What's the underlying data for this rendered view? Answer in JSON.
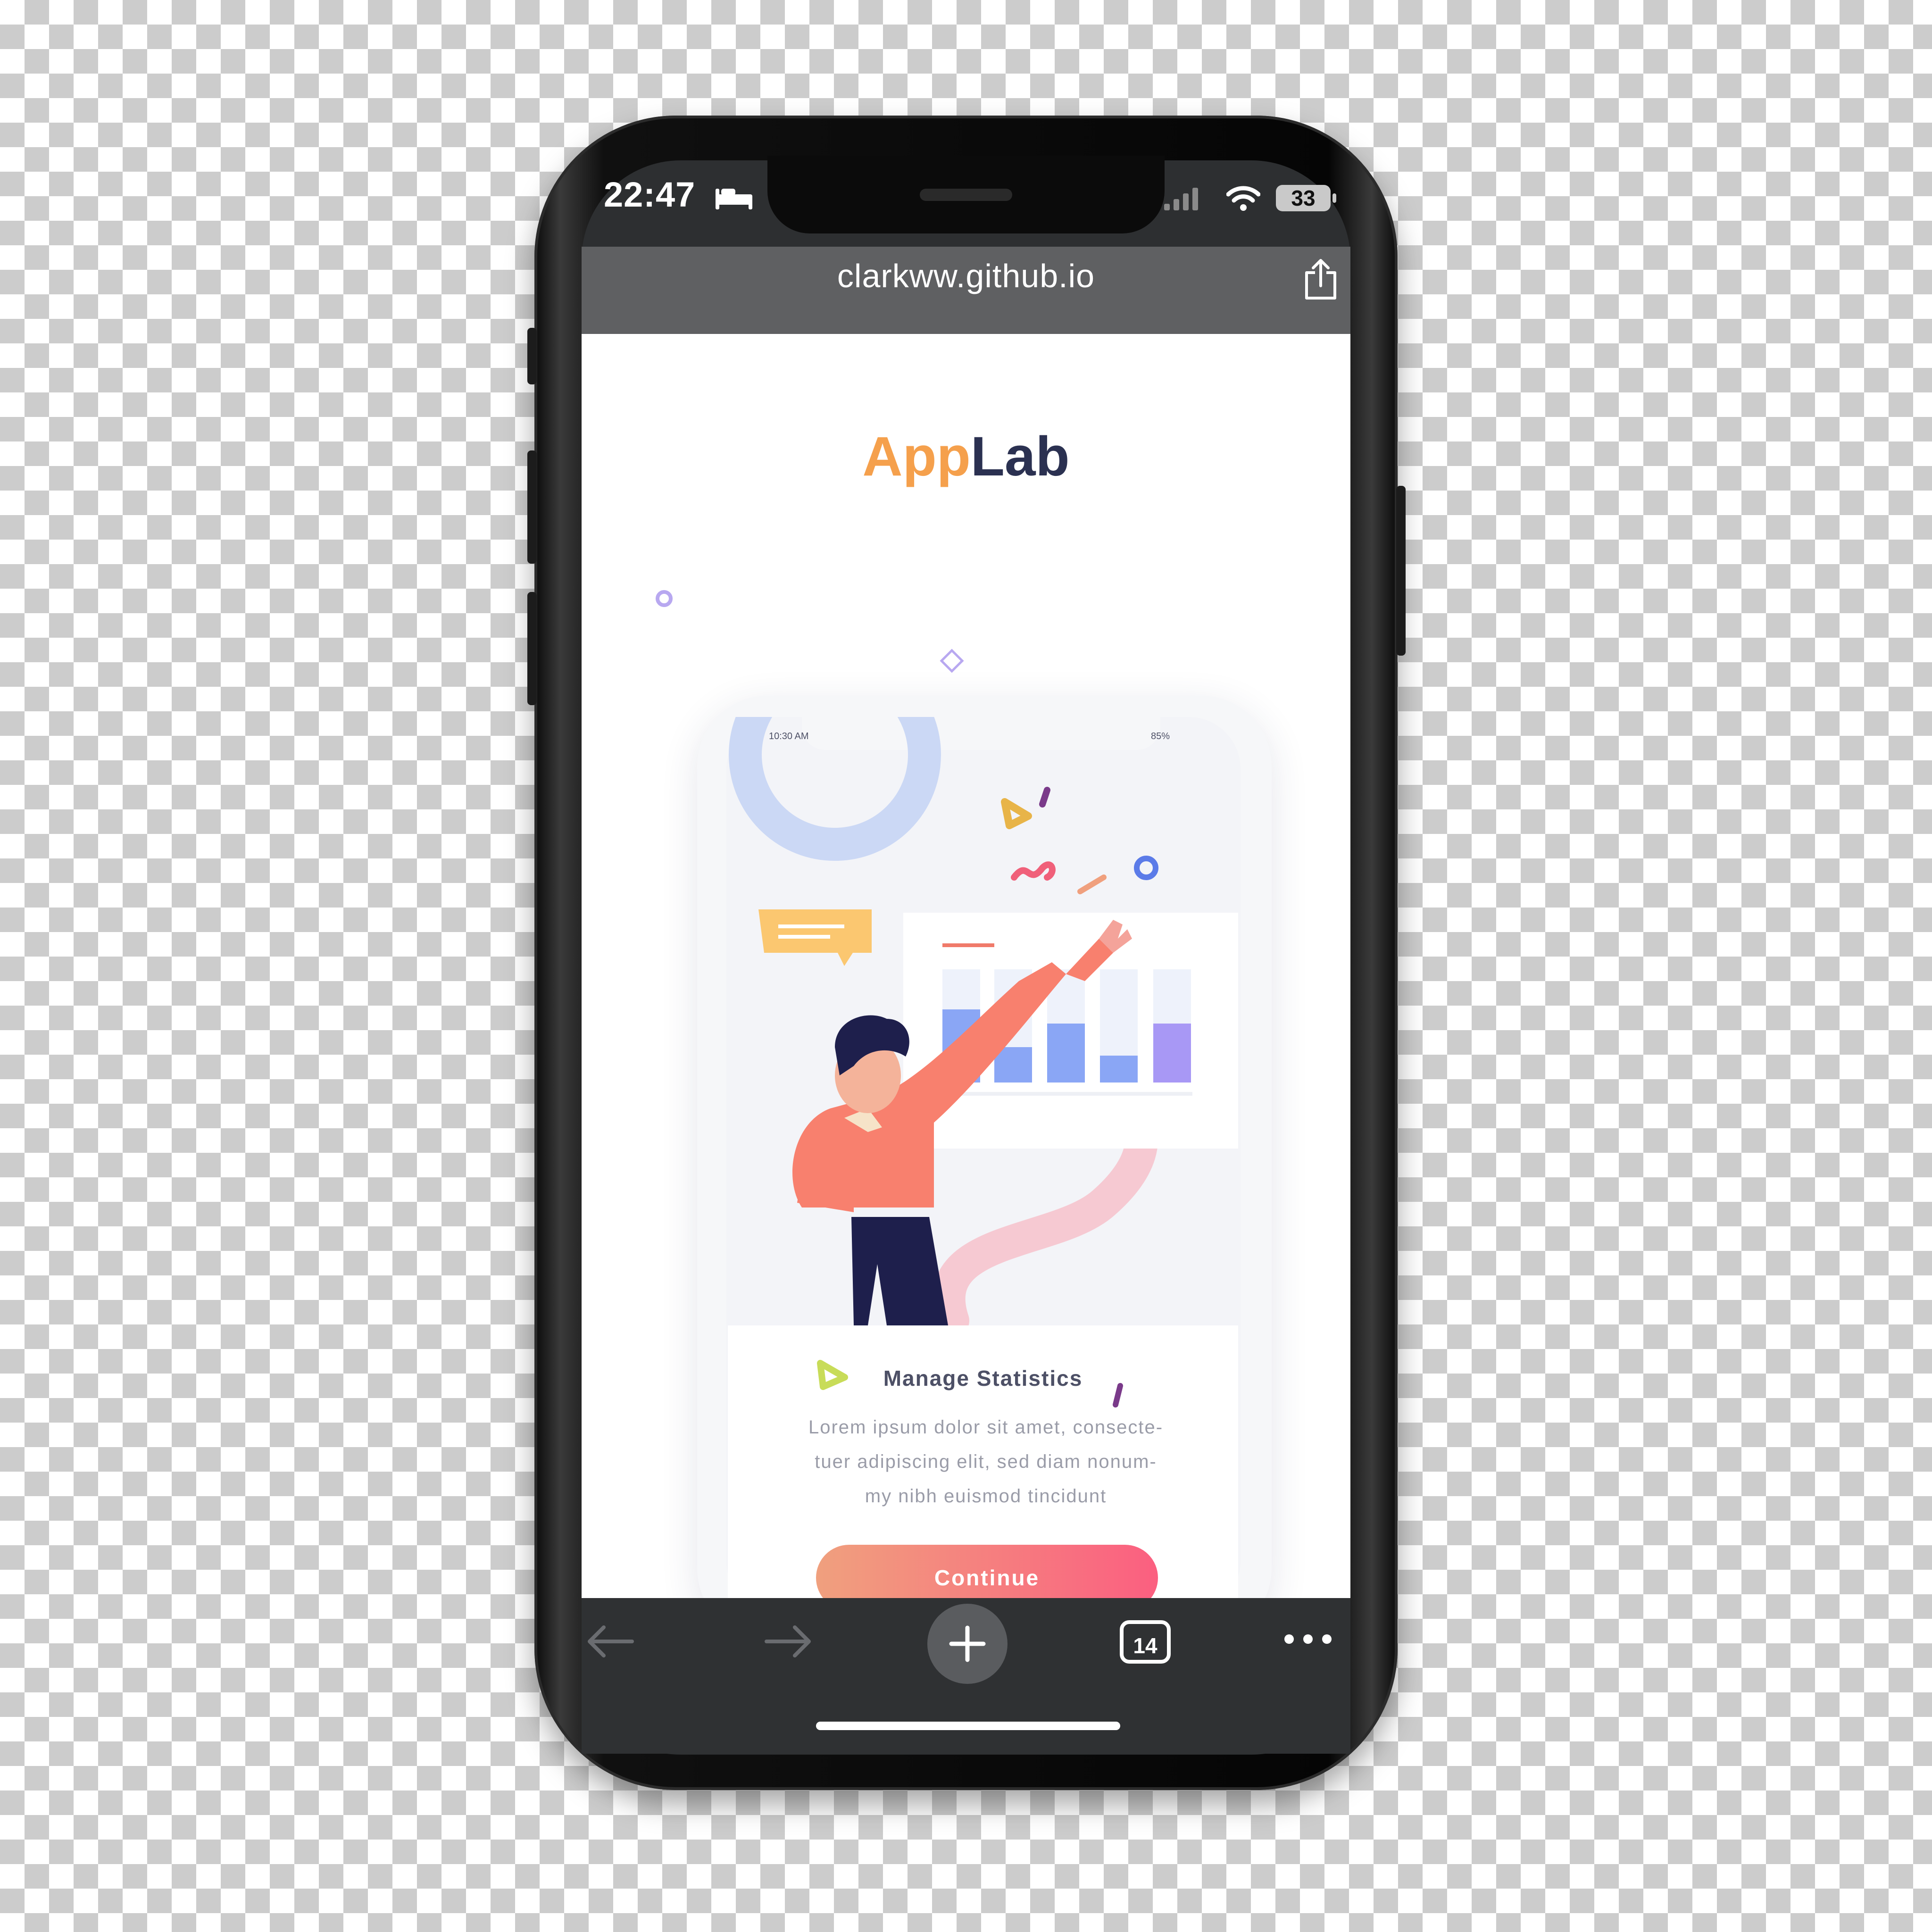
{
  "status_bar": {
    "time": "22:47",
    "battery": "33"
  },
  "browser": {
    "url": "clarkww.github.io",
    "tab_count": "14"
  },
  "page": {
    "brand_part1": "App",
    "brand_part2": "Lab",
    "inner_status_time": "10:30 AM",
    "inner_status_battery": "85%",
    "card_title": "Manage Statistics",
    "card_desc_line1": "Lorem ipsum dolor sit amet, consecte-",
    "card_desc_line2": "tuer adipiscing elit, sed diam nonum-",
    "card_desc_line3": "my nibh euismod tincidunt",
    "continue_label": "Continue"
  },
  "colors": {
    "brand_orange": "#f5a04c",
    "brand_navy": "#2b3151",
    "accent_pink": "#fb5f80",
    "accent_peach": "#f0a07e",
    "chart_blue": "#8aa6f5",
    "chart_purple": "#a898f5"
  },
  "icons": [
    "bed-icon",
    "signal-icon",
    "wifi-icon",
    "battery-icon",
    "share-icon",
    "back-arrow-icon",
    "forward-arrow-icon",
    "plus-icon",
    "tabs-icon",
    "more-icon"
  ]
}
